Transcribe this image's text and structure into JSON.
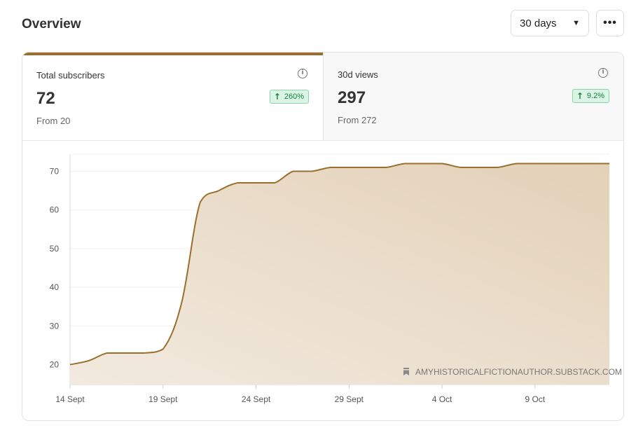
{
  "header": {
    "title": "Overview",
    "range_label": "30 days",
    "more_label": "•••"
  },
  "tabs": [
    {
      "label": "Total subscribers",
      "value": "72",
      "change": "260%",
      "from": "From 20"
    },
    {
      "label": "30d views",
      "value": "297",
      "change": "9.2%",
      "from": "From 272"
    }
  ],
  "colors": {
    "accent": "#9a6f2e",
    "area_fill_top": "#e4d3bb",
    "area_fill_bottom": "#f3ebe0",
    "positive": "#13813f"
  },
  "chart_data": {
    "type": "area",
    "title": "",
    "xlabel": "",
    "ylabel": "",
    "x": [
      "14 Sept",
      "15 Sept",
      "16 Sept",
      "17 Sept",
      "18 Sept",
      "19 Sept",
      "20 Sept",
      "21 Sept",
      "22 Sept",
      "23 Sept",
      "24 Sept",
      "25 Sept",
      "26 Sept",
      "27 Sept",
      "28 Sept",
      "29 Sept",
      "30 Sept",
      "1 Oct",
      "2 Oct",
      "3 Oct",
      "4 Oct",
      "5 Oct",
      "6 Oct",
      "7 Oct",
      "8 Oct",
      "9 Oct",
      "10 Oct",
      "11 Oct",
      "12 Oct",
      "13 Oct"
    ],
    "series": [
      {
        "values": [
          20,
          21,
          23,
          23,
          23,
          24,
          36,
          62,
          65,
          67,
          67,
          67,
          70,
          70,
          71,
          71,
          71,
          71,
          72,
          72,
          72,
          71,
          71,
          71,
          72,
          72,
          72,
          72,
          72,
          72
        ]
      }
    ],
    "x_ticks": [
      "14 Sept",
      "19 Sept",
      "24 Sept",
      "29 Sept",
      "4 Oct",
      "9 Oct"
    ],
    "y_ticks": [
      20,
      30,
      40,
      50,
      60,
      70
    ],
    "ylim": [
      15,
      74
    ],
    "grid": true,
    "watermark": "AMYHISTORICALFICTIONAUTHOR.SUBSTACK.COM"
  }
}
